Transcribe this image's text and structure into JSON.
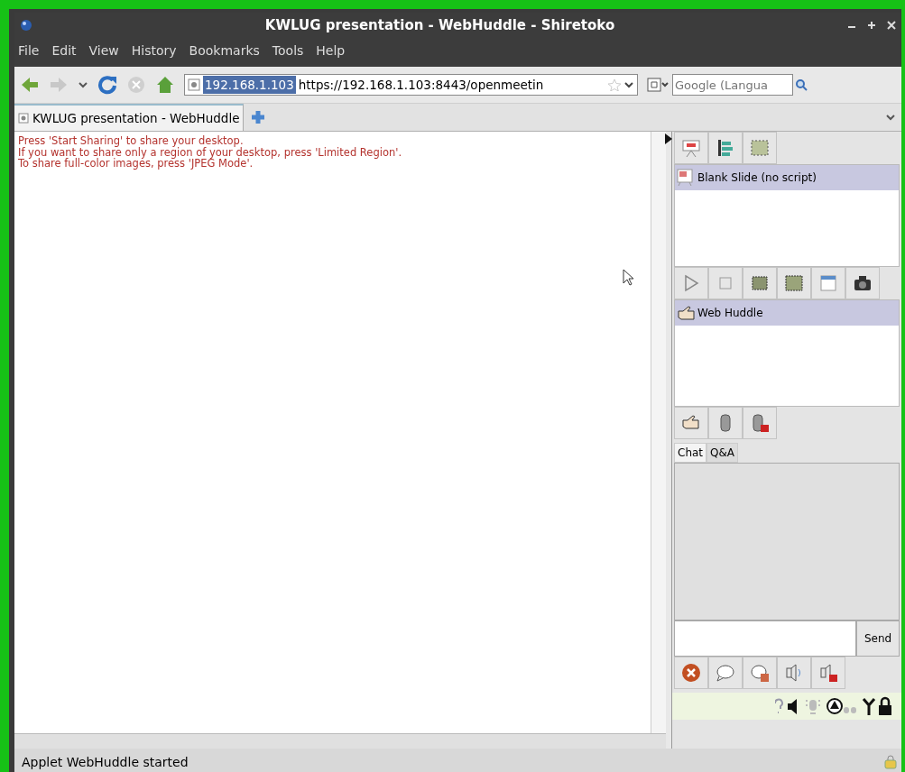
{
  "window": {
    "title": "KWLUG presentation - WebHuddle - Shiretoko"
  },
  "menu": [
    "File",
    "Edit",
    "View",
    "History",
    "Bookmarks",
    "Tools",
    "Help"
  ],
  "address": {
    "host": "192.168.1.103",
    "url": "https://192.168.1.103:8443/openmeetin"
  },
  "search": {
    "placeholder": "Google (Langua"
  },
  "tabs": [
    {
      "label": "KWLUG presentation - WebHuddle",
      "selected": true
    }
  ],
  "messages": [
    "Press 'Start Sharing' to share your desktop.",
    "If you want to share only a region of your desktop, press 'Limited Region'.",
    "To share full-color images, press 'JPEG Mode'."
  ],
  "slides": [
    {
      "label": "Blank Slide (no script)",
      "selected": true
    }
  ],
  "participants": [
    {
      "label": "Web Huddle",
      "selected": true
    }
  ],
  "chat_tabs": [
    {
      "label": "Chat",
      "selected": true
    },
    {
      "label": "Q&A",
      "selected": false
    }
  ],
  "send_button": "Send",
  "status_bar": "Applet WebHuddle started"
}
